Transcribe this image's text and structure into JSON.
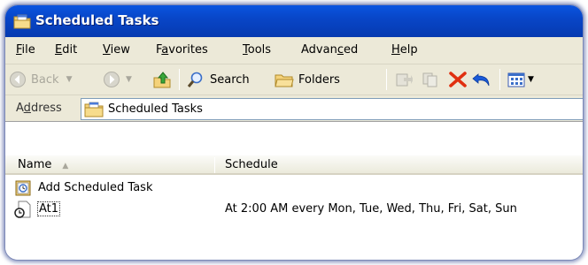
{
  "window": {
    "title": "Scheduled Tasks"
  },
  "menu": {
    "items": [
      {
        "label": "File",
        "accel": "F",
        "rest": "ile"
      },
      {
        "label": "Edit",
        "accel": "E",
        "rest": "dit"
      },
      {
        "label": "View",
        "accel": "V",
        "rest": "iew"
      },
      {
        "label": "Favorites",
        "pre": "F",
        "accel": "a",
        "rest": "vorites"
      },
      {
        "label": "Tools",
        "accel": "T",
        "rest": "ools"
      },
      {
        "label": "Advanced",
        "pre": "Advan",
        "accel": "c",
        "rest": "ed"
      },
      {
        "label": "Help",
        "accel": "H",
        "rest": "elp"
      }
    ]
  },
  "toolbar": {
    "back_label": "Back",
    "search_label": "Search",
    "folders_label": "Folders"
  },
  "address": {
    "label_accel": "d",
    "label_pre": "A",
    "label_rest": "dress",
    "value": "Scheduled Tasks"
  },
  "list": {
    "columns": [
      "Name",
      "Schedule"
    ],
    "rows": [
      {
        "name": "Add Scheduled Task",
        "schedule": ""
      },
      {
        "name": "At1",
        "schedule": "At 2:00 AM every Mon, Tue, Wed, Thu, Fri, Sat, Sun"
      }
    ]
  },
  "colors": {
    "titlebar": "#0846c8",
    "chrome": "#ece9d8",
    "delete_x": "#e03010",
    "undo": "#1a5ad8"
  }
}
